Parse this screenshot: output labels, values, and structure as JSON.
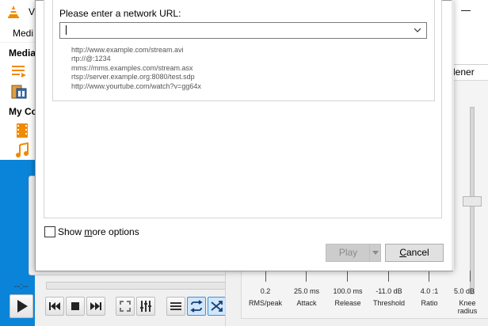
{
  "vlc": {
    "title": "V",
    "menu_media": "Medi",
    "sidebar": {
      "media_header": "Media",
      "mycomputer_header": "My Co"
    },
    "time": "--:--"
  },
  "effects": {
    "tab_label": "dener",
    "compressor": [
      {
        "value": "0.2",
        "label": "RMS/peak"
      },
      {
        "value": "25.0 ms",
        "label": "Attack"
      },
      {
        "value": "100.0 ms",
        "label": "Release"
      },
      {
        "value": "-11.0 dB",
        "label": "Threshold"
      },
      {
        "value": "4.0 :1",
        "label": "Ratio"
      },
      {
        "value": "5.0 dB",
        "label": "Knee radius"
      }
    ]
  },
  "dialog": {
    "url_label": "Please enter a network URL:",
    "url_value": "",
    "examples": [
      "http://www.example.com/stream.avi",
      "rtp://@:1234",
      "mms://mms.examples.com/stream.asx",
      "rtsp://server.example.org:8080/test.sdp",
      "http://www.yourtube.com/watch?v=gg64x"
    ],
    "show_more_prefix": "Show ",
    "show_more_accel": "m",
    "show_more_suffix": "ore options",
    "show_more_checked": false,
    "play_prefix": "",
    "play_label": "Play",
    "cancel_accel": "C",
    "cancel_suffix": "ancel"
  },
  "colors": {
    "accent_blue": "#0a84d8",
    "vlc_orange": "#f08a00"
  }
}
